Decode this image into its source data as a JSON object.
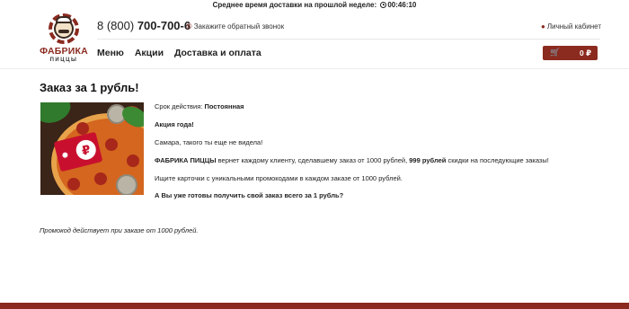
{
  "topbar": {
    "text": "Среднее время доставки на прошлой неделе:",
    "time": "00:46:10",
    "clock_icon": "clock-icon"
  },
  "logo": {
    "brand": "ФАБРИКА",
    "sub": "ПИЦЦЫ"
  },
  "header": {
    "phone_prefix": "8 (800)",
    "phone_number": "700-700-6",
    "callback_icon": "phone-icon",
    "callback_label": "Закажите обратный звонок",
    "cabinet_icon": "user-icon",
    "cabinet_label": "Личный кабинет"
  },
  "nav": {
    "items": [
      "Меню",
      "Акции",
      "Доставка и оплата"
    ]
  },
  "cart": {
    "icon": "cart-icon",
    "total": "0 ₽"
  },
  "page": {
    "title": "Заказ за 1 рубль!",
    "image_badge": "₽",
    "validity_label": "Срок действия:",
    "validity_value": "Постоянная",
    "headline": "Акция года!",
    "line_samara": "Самара, такого ты еще не видела!",
    "offer_brand": "ФАБРИКА ПИЦЦЫ",
    "offer_text_1": " вернет каждому клиенту, сделавшему заказ от 1000 рублей, ",
    "offer_amount": "999 рублей",
    "offer_text_2": " скидки на последующие заказы!",
    "cards_line": "Ищите карточки с уникальными промокодами в каждом заказе от 1000 рублей.",
    "question": "А Вы уже готовы получить свой заказ всего за 1 рубль?",
    "footnote": "Промокод действует при заказе от 1000 рублей."
  },
  "colors": {
    "brand": "#8b2a1f",
    "text": "#222222"
  }
}
